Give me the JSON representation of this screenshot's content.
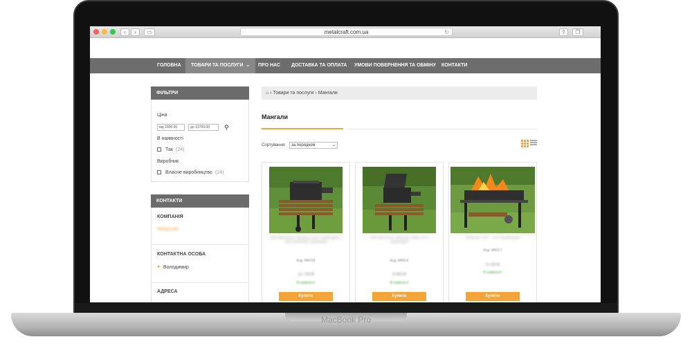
{
  "browser": {
    "url": "metalcraft.com.ua"
  },
  "nav": [
    "ГОЛОВНА",
    "ТОВАРИ ТА ПОСЛУГИ",
    "ПРО НАС",
    "ДОСТАВКА ТА ОПЛАТА",
    "УМОВИ ПОВЕРНЕННЯ ТА ОБМІНУ",
    "КОНТАКТИ"
  ],
  "filters": {
    "title": "ФІЛЬТРИ",
    "price_label": "Ціна",
    "price_from": "від 1600.00",
    "price_to": "до 12700.00",
    "availability_label": "В наявності",
    "availability_option": "Так",
    "availability_count": "(24)",
    "manufacturer_label": "Виробник",
    "manufacturer_option": "Власне виробництво",
    "manufacturer_count": "(24)"
  },
  "contacts": {
    "title": "КОНТАКТИ",
    "company_label": "КОМПАНІЯ",
    "company_value": "Metalcraft",
    "person_label": "КОНТАКТНА ОСОБА",
    "person_value": "Володимир",
    "address_label": "АДРЕСА"
  },
  "breadcrumb": "› Товари та послуги › Мангали",
  "page_title": "Мангали",
  "sort": {
    "label": "Сортування:",
    "value": "за порядком"
  },
  "products": [
    {
      "name": "Автомобільні Мангал на 8 шампурів з металевими ґратками",
      "code": "Код: МК019",
      "price": "10 700 ₴",
      "stock": "В наявності",
      "buy": "Купити"
    },
    {
      "name": "Автомобільні мангал 6мм на 8 шампурів",
      "code": "Код: МК014",
      "price": "9 900 ₴",
      "stock": "В наявності",
      "buy": "Купити"
    },
    {
      "name": "Мангал LOFT на 8 шампурів",
      "code": "Код: МК017",
      "price": "4 700 ₴",
      "stock": "В наявності",
      "buy": "Купити"
    }
  ],
  "device": {
    "label": "MacBook Pro"
  }
}
